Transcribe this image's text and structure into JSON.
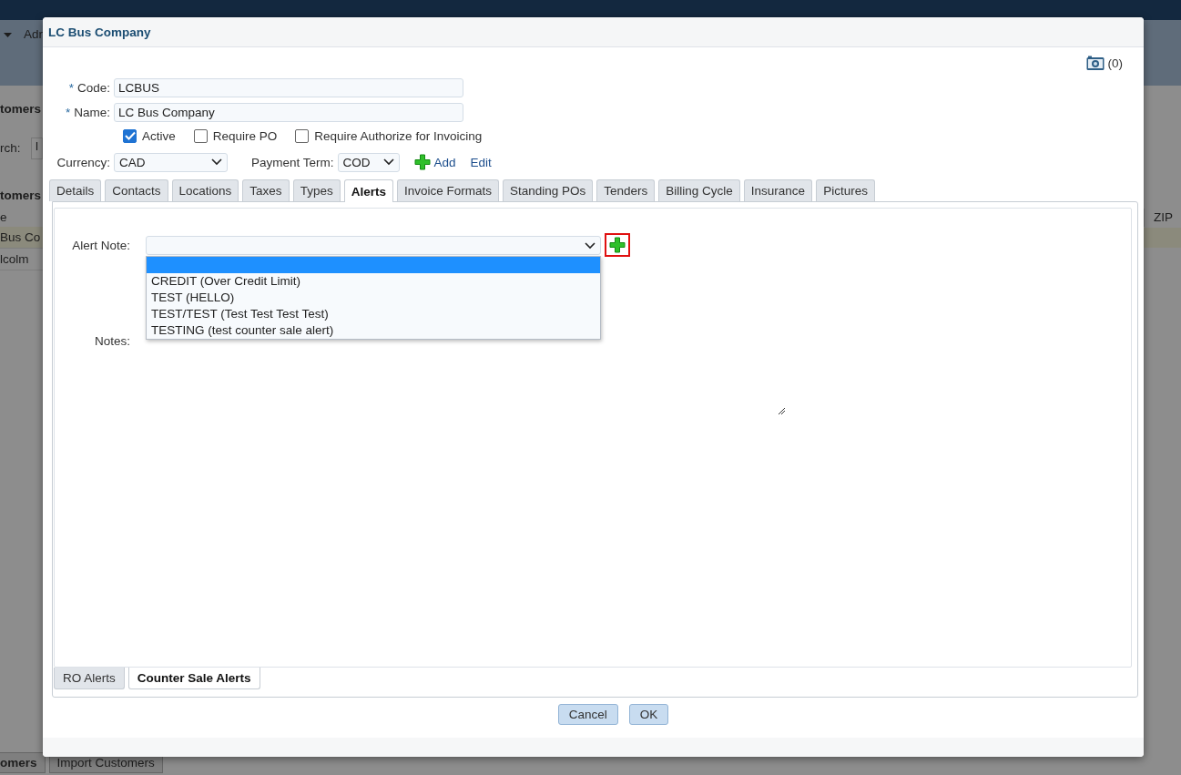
{
  "background": {
    "nav_label": "Adr",
    "section_title": "tomers",
    "search_label": "rch:",
    "search_value": "l",
    "list_title": "tomers",
    "column_1": "e",
    "column_2": "ZIP",
    "rows": [
      {
        "text": "Bus Co",
        "selected": true
      },
      {
        "text": "lcolm",
        "selected": false
      }
    ],
    "footer_buttons": [
      "omers",
      "Import Customers"
    ]
  },
  "dialog": {
    "title": "LC Bus Company",
    "attachments": "(0)",
    "fields": [
      {
        "label": "Code:",
        "required_mark": "*",
        "value": "LCBUS"
      },
      {
        "label": "Name:",
        "required_mark": "*",
        "value": "LC Bus Company"
      }
    ],
    "checkboxes": [
      {
        "label": "Active",
        "checked": true
      },
      {
        "label": "Require PO",
        "checked": false
      },
      {
        "label": "Require Authorize for Invoicing",
        "checked": false
      }
    ],
    "currency": {
      "label": "Currency:",
      "value": "CAD"
    },
    "payment_term": {
      "label": "Payment Term:",
      "value": "COD",
      "add": "Add",
      "edit": "Edit"
    },
    "tabs": [
      {
        "label": "Details",
        "selected": false
      },
      {
        "label": "Contacts",
        "selected": false
      },
      {
        "label": "Locations",
        "selected": false
      },
      {
        "label": "Taxes",
        "selected": false
      },
      {
        "label": "Types",
        "selected": false
      },
      {
        "label": "Alerts",
        "selected": true
      },
      {
        "label": "Invoice Formats",
        "selected": false
      },
      {
        "label": "Standing POs",
        "selected": false
      },
      {
        "label": "Tenders",
        "selected": false
      },
      {
        "label": "Billing Cycle",
        "selected": false
      },
      {
        "label": "Insurance",
        "selected": false
      },
      {
        "label": "Pictures",
        "selected": false
      }
    ],
    "alert_note": {
      "label": "Alert Note:",
      "highlighted": true,
      "options": [
        {
          "selected": true
        },
        {
          "text": "CREDIT (Over Credit Limit)",
          "selected": false
        },
        {
          "text": "TEST (HELLO)",
          "selected": false
        },
        {
          "text": "TEST/TEST (Test Test Test Test)",
          "selected": false
        },
        {
          "text": "TESTING (test counter sale alert)",
          "selected": false
        }
      ]
    },
    "notes": {
      "label": "Notes:"
    },
    "sub_tabs": [
      {
        "label": "RO Alerts",
        "selected": false
      },
      {
        "label": "Counter Sale Alerts",
        "selected": true
      }
    ],
    "buttons": [
      "Cancel",
      "OK"
    ]
  }
}
